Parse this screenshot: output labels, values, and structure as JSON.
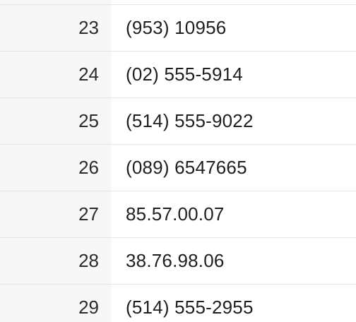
{
  "table": {
    "rows": [
      {
        "num": "23",
        "phone": "(953) 10956"
      },
      {
        "num": "24",
        "phone": "(02) 555-5914"
      },
      {
        "num": "25",
        "phone": "(514) 555-9022"
      },
      {
        "num": "26",
        "phone": "(089) 6547665"
      },
      {
        "num": "27",
        "phone": "85.57.00.07"
      },
      {
        "num": "28",
        "phone": "38.76.98.06"
      },
      {
        "num": "29",
        "phone": "(514) 555-2955"
      }
    ]
  }
}
